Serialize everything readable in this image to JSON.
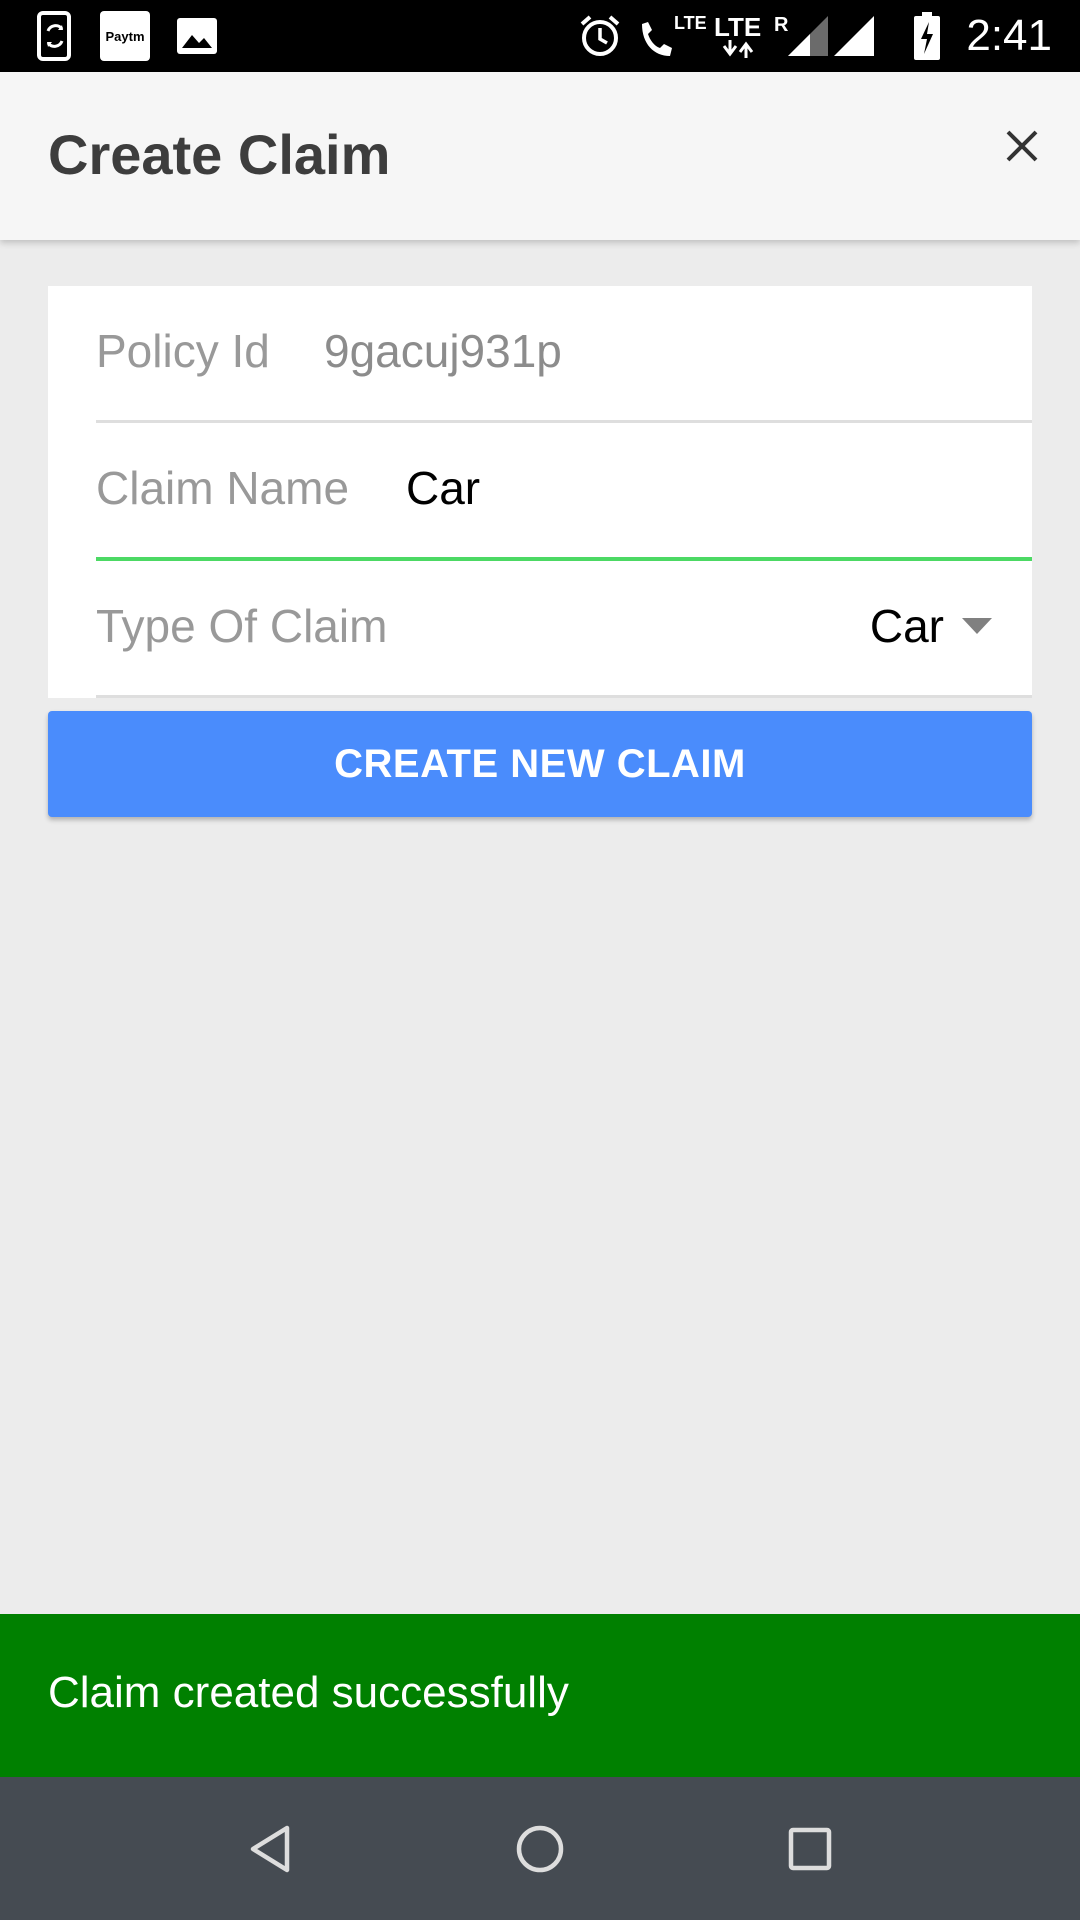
{
  "status_bar": {
    "time": "2:41",
    "icons": [
      "phone-sync-icon",
      "paytm-icon",
      "image-icon",
      "alarm-icon",
      "volte-call-icon",
      "lte-data-icon",
      "signal-roaming-icon",
      "signal-icon",
      "battery-charging-icon"
    ],
    "paytm_text": "Paytm",
    "lte_call_text": "LTE",
    "lte_data_text": "LTE",
    "roaming_text": "R"
  },
  "app_bar": {
    "title": "Create Claim",
    "close_icon": "close-icon"
  },
  "form": {
    "policy_id": {
      "label": "Policy Id",
      "value": "9gacuj931p"
    },
    "claim_name": {
      "label": "Claim Name",
      "value": "Car"
    },
    "type_of_claim": {
      "label": "Type Of Claim",
      "value": "Car"
    }
  },
  "create_button": {
    "label": "CREATE NEW CLAIM"
  },
  "toast": {
    "message": "Claim created successfully"
  },
  "colors": {
    "accent_blue": "#4a8cfc",
    "active_underline": "#4cd964",
    "toast_green": "#008000",
    "nav_bar": "#454b52"
  },
  "nav_bar": {
    "icons": [
      "back-icon",
      "home-icon",
      "recents-icon"
    ]
  }
}
